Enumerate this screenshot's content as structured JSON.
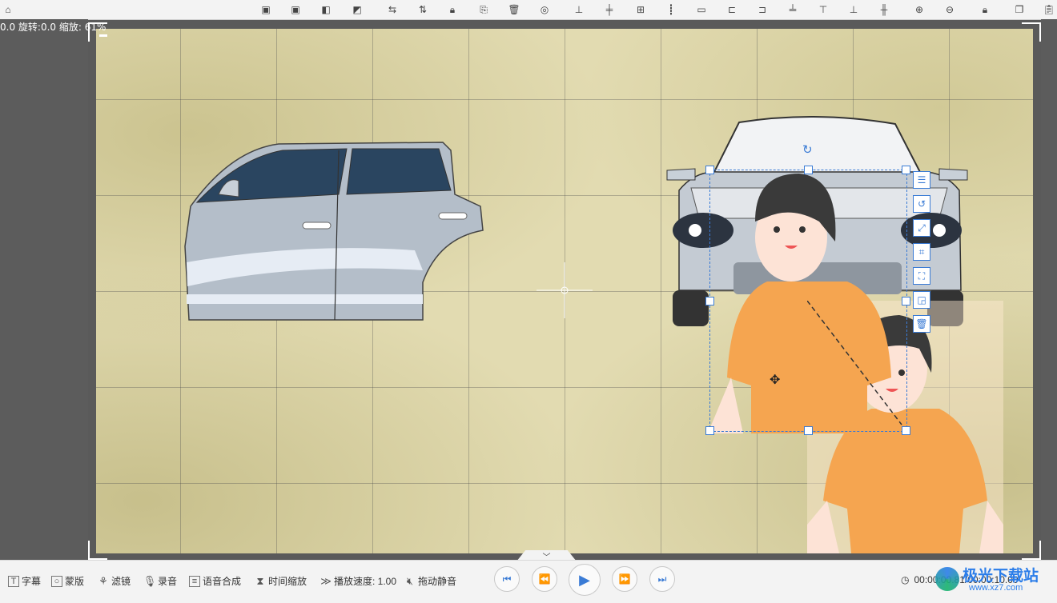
{
  "status": {
    "text": "0.0 旋转:0.0 缩放: 61%"
  },
  "toolbar": {
    "icons": [
      "home-icon",
      "bring-forward-icon",
      "send-backward-icon",
      "bring-front-icon",
      "send-back-icon",
      "flip-horizontal-icon",
      "flip-vertical-icon",
      "lock-icon",
      "replace-icon",
      "delete-icon",
      "copy-style-icon",
      "align-center-h-icon",
      "align-center-v-icon",
      "distribute-icon",
      "align-left-edge-icon",
      "same-width-icon",
      "align-left-icon",
      "align-right-icon",
      "align-center-icon",
      "align-top-icon",
      "align-bottom-icon",
      "align-middle-icon",
      "zoom-in-icon",
      "zoom-out-icon",
      "lock-ratio-icon",
      "copy-icon",
      "paste-icon"
    ]
  },
  "selection_tools": [
    "align-icon",
    "rotate-icon",
    "fit-icon",
    "crop-icon",
    "fullscreen-icon",
    "layer-icon",
    "trash-icon"
  ],
  "bottom": {
    "subtitle": "字幕",
    "mask": "蒙版",
    "filter": "滤镜",
    "record": "录音",
    "tts": "语音合成",
    "time_zoom": "时间缩放",
    "speed": "播放速度: 1.00",
    "mute": "拖动静音",
    "timecode": "00:00:00.81/00:00:10.00"
  },
  "watermark": {
    "title": "极光下载站",
    "url": "www.xz7.com"
  },
  "colors": {
    "accent": "#3a7bd5",
    "paper": "#e2dbb1",
    "shirt": "#f5a550",
    "hair": "#3a3a3a"
  }
}
